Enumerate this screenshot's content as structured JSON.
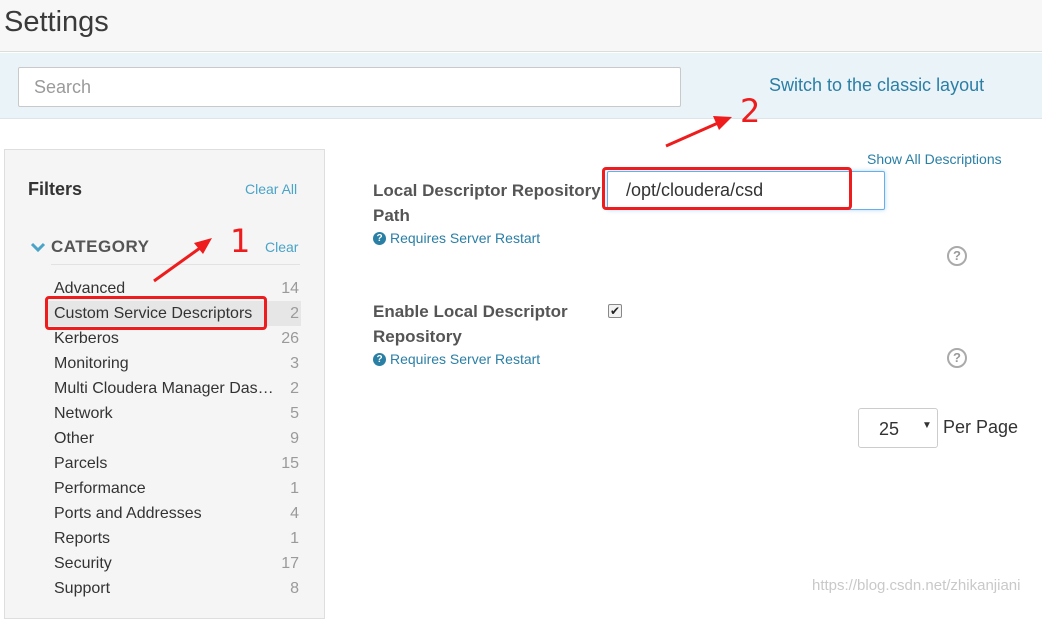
{
  "page": {
    "title": "Settings"
  },
  "search": {
    "placeholder": "Search",
    "value": ""
  },
  "switch_layout_link": "Switch to the classic layout",
  "filters": {
    "title": "Filters",
    "clear_all": "Clear All",
    "category": {
      "title": "CATEGORY",
      "clear": "Clear",
      "items": [
        {
          "label": "Advanced",
          "count": "14"
        },
        {
          "label": "Custom Service Descriptors",
          "count": "2",
          "selected": true
        },
        {
          "label": "Kerberos",
          "count": "26"
        },
        {
          "label": "Monitoring",
          "count": "3"
        },
        {
          "label": "Multi Cloudera Manager Dashboard",
          "count": "2"
        },
        {
          "label": "Network",
          "count": "5"
        },
        {
          "label": "Other",
          "count": "9"
        },
        {
          "label": "Parcels",
          "count": "15"
        },
        {
          "label": "Performance",
          "count": "1"
        },
        {
          "label": "Ports and Addresses",
          "count": "4"
        },
        {
          "label": "Reports",
          "count": "1"
        },
        {
          "label": "Security",
          "count": "17"
        },
        {
          "label": "Support",
          "count": "8"
        }
      ]
    }
  },
  "main": {
    "show_all_descriptions": "Show All Descriptions",
    "settings": [
      {
        "label": "Local Descriptor Repository Path",
        "restart_note": "Requires Server Restart",
        "value": "/opt/cloudera/csd"
      },
      {
        "label": "Enable Local Descriptor Repository",
        "restart_note": "Requires Server Restart",
        "checked": true
      }
    ],
    "pagination": {
      "per_page_value": "25",
      "per_page_label": "Per Page"
    }
  },
  "annotations": {
    "marker_1": "1",
    "marker_2": "2",
    "color": "#ee1c1c"
  },
  "icons": {
    "info": "?",
    "help": "?",
    "checkmark": "✔",
    "caret": "▼"
  },
  "colors": {
    "link": "#2a7fa5",
    "filter_link": "#4aa3c8",
    "accent": "#66afe9"
  },
  "watermark": "https://blog.csdn.net/zhikanjiani"
}
